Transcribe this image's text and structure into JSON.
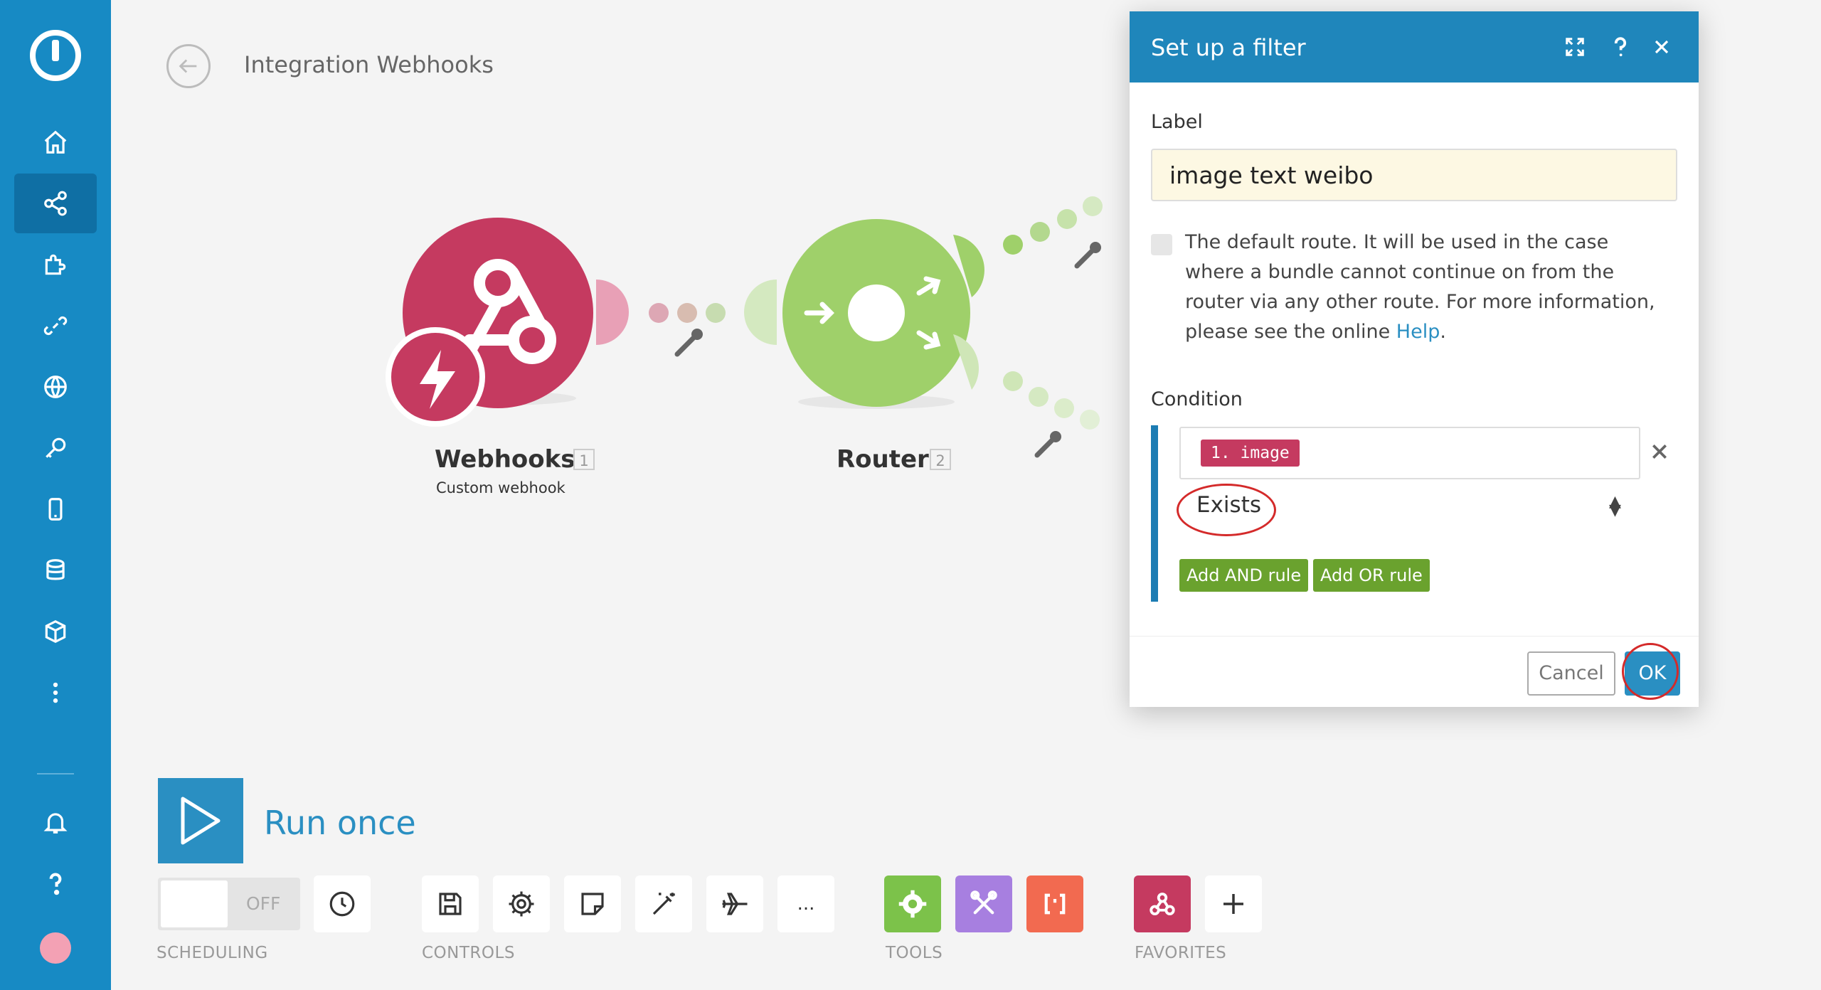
{
  "header": {
    "title": "Integration Webhooks"
  },
  "sidebar": {
    "items": [
      {
        "icon": "home-icon"
      },
      {
        "icon": "share-icon",
        "active": true
      },
      {
        "icon": "puzzle-icon"
      },
      {
        "icon": "link-icon"
      },
      {
        "icon": "globe-icon"
      },
      {
        "icon": "key-icon"
      },
      {
        "icon": "mobile-icon"
      },
      {
        "icon": "database-icon"
      },
      {
        "icon": "cube-icon"
      },
      {
        "icon": "more-icon"
      }
    ],
    "bottom_items": [
      {
        "icon": "bell-icon"
      },
      {
        "icon": "help-icon"
      },
      {
        "icon": "avatar-icon"
      }
    ]
  },
  "modules": {
    "webhooks": {
      "name": "Webhooks",
      "index": "1",
      "subtitle": "Custom webhook",
      "color": "#c53a60"
    },
    "router": {
      "name": "Router",
      "index": "2",
      "color": "#9fd06a"
    }
  },
  "toolbar": {
    "run_label": "Run once",
    "toggle_label": "OFF",
    "scheduling_label": "SCHEDULING",
    "controls_label": "CONTROLS",
    "tools_label": "TOOLS",
    "favorites_label": "FAVORITES",
    "more_label": "..."
  },
  "dialog": {
    "title": "Set up a filter",
    "label_heading": "Label",
    "label_value": "image text weibo",
    "default_route_text": "The default route. It will be used in the case where a bundle cannot continue on from the router via any other route. For more information, please see the online",
    "help_link": "Help",
    "period": ".",
    "condition_heading": "Condition",
    "condition_pill": "1. image",
    "operator": "Exists",
    "add_and_rule": "Add AND rule",
    "add_or_rule": "Add OR rule",
    "cancel": "Cancel",
    "ok": "OK"
  },
  "colors": {
    "sidebar": "#178ac4",
    "accent": "#2a8fc2",
    "webhook": "#c53a60",
    "router": "#9fd06a",
    "tools_green": "#7cc24a",
    "tools_purple": "#a77fe0",
    "tools_red": "#f26a50"
  }
}
